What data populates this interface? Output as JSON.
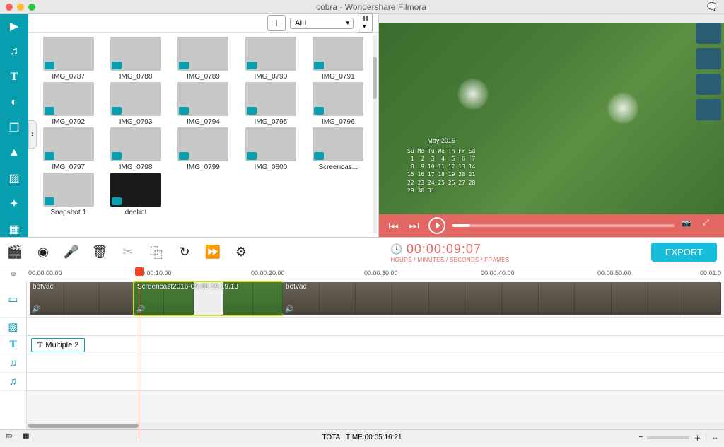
{
  "window": {
    "title": "cobra - Wondershare Filmora"
  },
  "mediaToolbar": {
    "filter": "ALL"
  },
  "thumbs": [
    {
      "name": "IMG_0787"
    },
    {
      "name": "IMG_0788"
    },
    {
      "name": "IMG_0789"
    },
    {
      "name": "IMG_0790"
    },
    {
      "name": "IMG_0791"
    },
    {
      "name": "IMG_0792"
    },
    {
      "name": "IMG_0793"
    },
    {
      "name": "IMG_0794"
    },
    {
      "name": "IMG_0795"
    },
    {
      "name": "IMG_0796"
    },
    {
      "name": "IMG_0797"
    },
    {
      "name": "IMG_0798"
    },
    {
      "name": "IMG_0799"
    },
    {
      "name": "IMG_0800"
    },
    {
      "name": "Screencas..."
    },
    {
      "name": "Snapshot 1"
    },
    {
      "name": "deebot"
    }
  ],
  "preview": {
    "calendar_title": "May 2016",
    "calendar": "Su Mo Tu We Th Fr Sa\n 1  2  3  4  5  6  7\n 8  9 10 11 12 13 14\n15 16 17 18 19 20 21\n22 23 24 25 26 27 28\n29 30 31"
  },
  "playhead": {
    "timecode": "00:00:09:07",
    "label": "HOURS / MINUTES / SECONDS / FRAMES"
  },
  "export": {
    "label": "EXPORT"
  },
  "ruler": [
    "00:00:00:00",
    "00:00:10:00",
    "00:00:20:00",
    "00:00:30:00",
    "00:00:40:00",
    "00:00:50:00",
    "00:01:0"
  ],
  "clips": {
    "v1_a": "botvac",
    "v1_b": "Screencast2016-05-03 19.19.13",
    "v1_c": "botvac",
    "text1": "Multiple 2"
  },
  "status": {
    "total": "TOTAL TIME:00:05:16:21"
  }
}
